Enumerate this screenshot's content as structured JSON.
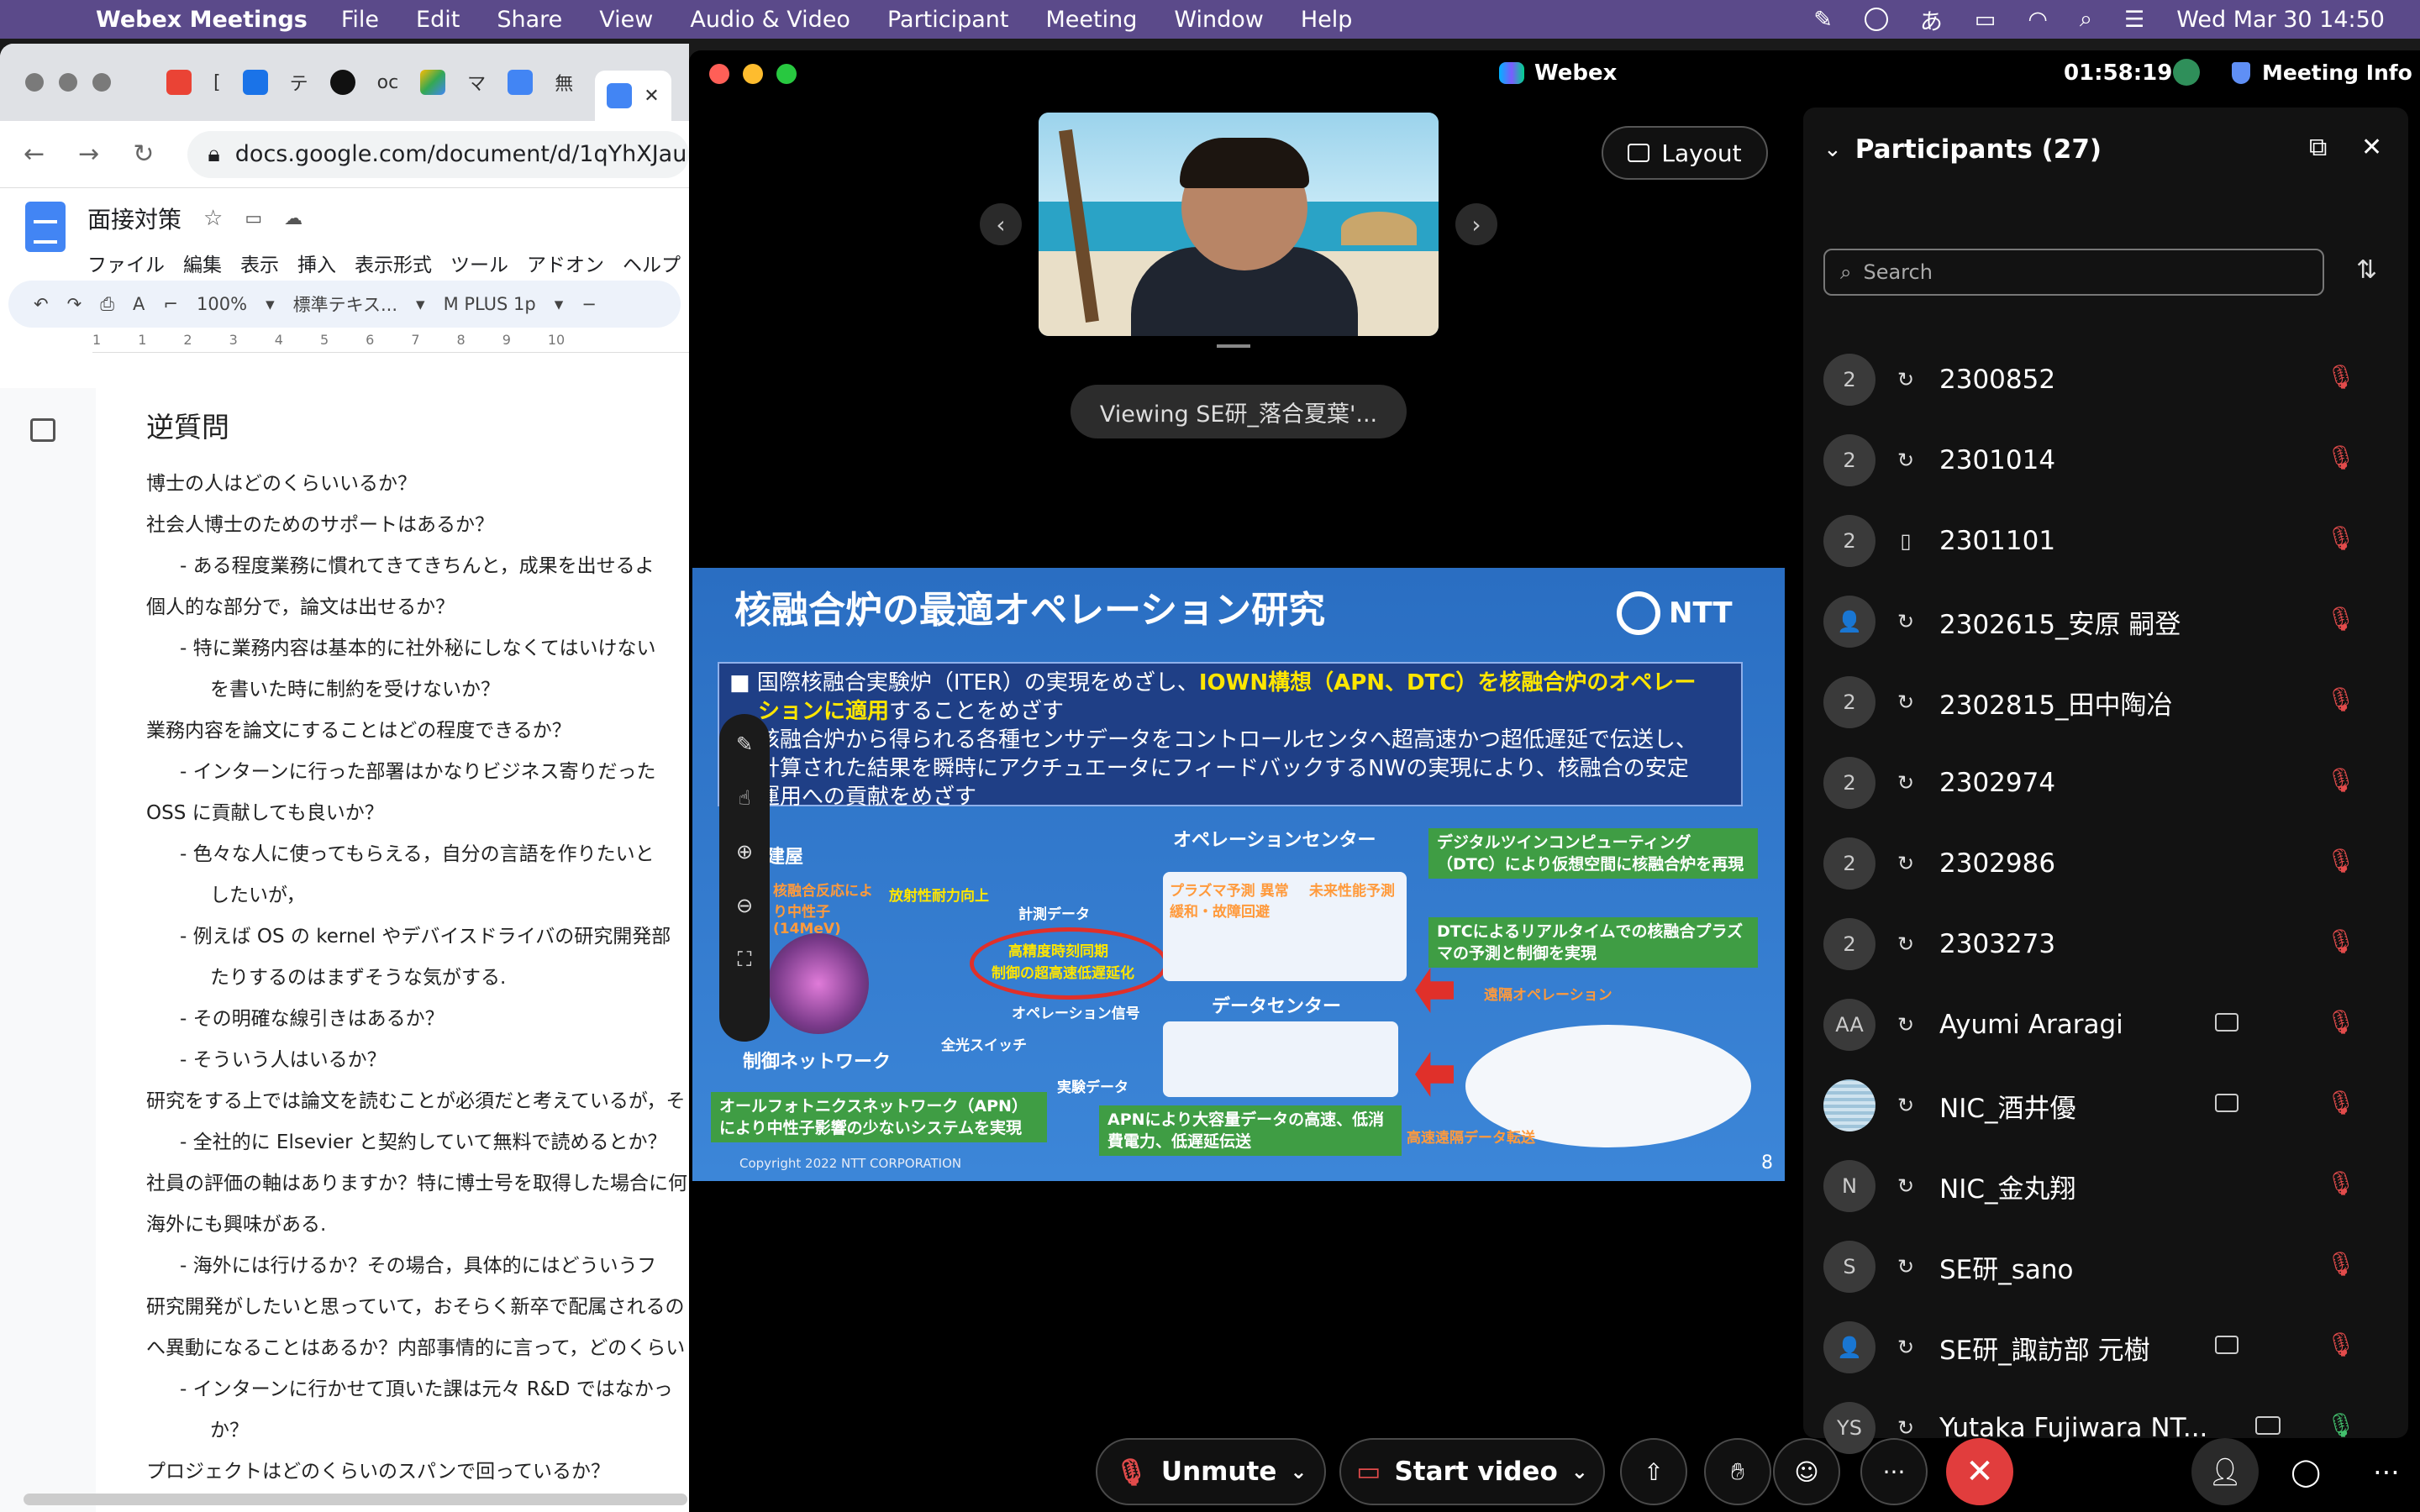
{
  "menubar": {
    "app": "Webex Meetings",
    "items": [
      "File",
      "Edit",
      "Share",
      "View",
      "Audio & Video",
      "Participant",
      "Meeting",
      "Window",
      "Help"
    ],
    "ime": "あ",
    "clock": "Wed Mar 30  14:50"
  },
  "chrome": {
    "tab_letters": [
      "[",
      "テ",
      "oc",
      "マ",
      "無"
    ],
    "url": "docs.google.com/document/d/1qYhXJau",
    "doc_title": "面接対策",
    "doc_menu": [
      "ファイル",
      "編集",
      "表示",
      "挿入",
      "表示形式",
      "ツール",
      "アドオン",
      "ヘルプ"
    ],
    "zoom": "100%",
    "style": "標準テキス...",
    "font": "M PLUS 1p",
    "ruler_marks": [
      "1",
      "1",
      "2",
      "3",
      "4",
      "5",
      "6",
      "7",
      "8",
      "9",
      "10"
    ],
    "heading": "逆質問",
    "lines": [
      {
        "lvl": "a",
        "text": "博士の人はどのくらいいるか？"
      },
      {
        "lvl": "a",
        "text": "社会人博士のためのサポートはあるか？"
      },
      {
        "lvl": "b",
        "text": "-    ある程度業務に慣れてきてきちんと，成果を出せるよ"
      },
      {
        "lvl": "a",
        "text": "個人的な部分で，論文は出せるか？"
      },
      {
        "lvl": "b",
        "text": "-    特に業務内容は基本的に社外秘にしなくてはいけない"
      },
      {
        "lvl": "c",
        "text": "を書いた時に制約を受けないか？"
      },
      {
        "lvl": "a",
        "text": "業務内容を論文にすることはどの程度できるか？"
      },
      {
        "lvl": "b",
        "text": "-    インターンに行った部署はかなりビジネス寄りだった"
      },
      {
        "lvl": "a",
        "text": "OSS に貢献しても良いか？"
      },
      {
        "lvl": "b",
        "text": "-    色々な人に使ってもらえる，自分の言語を作りたいと"
      },
      {
        "lvl": "c",
        "text": "したいが，"
      },
      {
        "lvl": "b",
        "text": "-    例えば OS の kernel やデバイスドライバの研究開発部"
      },
      {
        "lvl": "c",
        "text": "たりするのはまずそうな気がする."
      },
      {
        "lvl": "b",
        "text": "-    その明確な線引きはあるか？"
      },
      {
        "lvl": "b",
        "text": "-    そういう人はいるか？"
      },
      {
        "lvl": "a",
        "text": "研究をする上では論文を読むことが必須だと考えているが，そ"
      },
      {
        "lvl": "b",
        "text": "-    全社的に Elsevier と契約していて無料で読めるとか？"
      },
      {
        "lvl": "a",
        "text": "社員の評価の軸はありますか？特に博士号を取得した場合に何"
      },
      {
        "lvl": "a",
        "text": "海外にも興味がある."
      },
      {
        "lvl": "b",
        "text": "-    海外には行けるか？その場合，具体的にはどういうフ"
      },
      {
        "lvl": "a",
        "text": "研究開発がしたいと思っていて，おそらく新卒で配属されるの"
      },
      {
        "lvl": "a",
        "text": "へ異動になることはあるか？内部事情的に言って，どのくらい"
      },
      {
        "lvl": "b",
        "text": "-    インターンに行かせて頂いた課は元々 R&D ではなかっ"
      },
      {
        "lvl": "c",
        "text": "か？"
      },
      {
        "lvl": "a",
        "text": "プロジェクトはどのくらいのスパンで回っているか？"
      }
    ]
  },
  "webex": {
    "title": "Webex",
    "timer": "01:58:19",
    "meeting_info": "Meeting Info",
    "layout": "Layout",
    "viewing": "Viewing SE研_落合夏葉'...",
    "slide": {
      "title": "核融合炉の最適オペレーション研究",
      "logo": "NTT",
      "box_line1_a": "■ 国際核融合実験炉（ITER）の実現をめざし、",
      "box_line1_b": "IOWN構想（APN、DTC）を核融合炉のオペレー",
      "box_line2_a": "ションに適用",
      "box_line2_b": "することをめざす",
      "box_line3": "核融合炉から得られる各種センサデータをコントロールセンタへ超高速かつ超低遅延で伝送し、",
      "box_line4": "計算された結果を瞬時にアクチュエータにフィードバックするNWの実現により、核融合の安定",
      "box_line5": "運用への貢献をめざす",
      "building": "建屋",
      "op_center": "オペレーションセンター",
      "dtc_box": "デジタルツインコンピューティング（DTC）により仮想空間に核融合炉を再現",
      "dtc_rt": "DTCによるリアルタイムでの核融合プラズマの予測と制御を実現",
      "data_center": "データセンター",
      "control_nw": "制御ネットワーク",
      "apn_box": "オールフォトニクスネットワーク（APN）により中性子影響の少ないシステムを実現",
      "apn_dc": "APNにより大容量データの高速、低消費電力、低遅延伝送",
      "remote_op": "遠隔オペレーション",
      "remote_data": "高速遠隔データ転送",
      "measure": "計測データ",
      "op_signal": "オペレーション信号",
      "exp_data": "実験データ",
      "sync": "高精度時刻同期",
      "low_latency": "制御の超高速低遅延化",
      "radiation": "放射性耐力向上",
      "optical_switch": "全光スイッチ",
      "plasma": "プラズマ予測 異常緩和・故障回避",
      "future": "未来性能予測",
      "neutron": "核融合反応により中性子(14MeV)",
      "copyright": "Copyright 2022 NTT CORPORATION",
      "page": "8"
    },
    "participants": {
      "title": "Participants (27)",
      "search_placeholder": "Search",
      "list": [
        {
          "avatar": "2",
          "name": "2300852",
          "conn": "↻",
          "mic": "off"
        },
        {
          "avatar": "2",
          "name": "2301014",
          "conn": "↻",
          "mic": "off"
        },
        {
          "avatar": "2",
          "name": "2301101",
          "conn": "▯",
          "mic": "off"
        },
        {
          "avatar": "👤",
          "name": "2302615_安原 嗣登",
          "conn": "↻",
          "mic": "off"
        },
        {
          "avatar": "2",
          "name": "2302815_田中陶冶",
          "conn": "↻",
          "mic": "off"
        },
        {
          "avatar": "2",
          "name": "2302974",
          "conn": "↻",
          "mic": "off"
        },
        {
          "avatar": "2",
          "name": "2302986",
          "conn": "↻",
          "mic": "off"
        },
        {
          "avatar": "2",
          "name": "2303273",
          "conn": "↻",
          "mic": "off"
        },
        {
          "avatar": "AA",
          "name": "Ayumi Araragi",
          "conn": "↻",
          "mic": "off",
          "badge": true
        },
        {
          "avatar": "",
          "name": "NIC_酒井優",
          "conn": "↻",
          "mic": "off",
          "badge": true,
          "img": true
        },
        {
          "avatar": "N",
          "name": "NIC_金丸翔",
          "conn": "↻",
          "mic": "off"
        },
        {
          "avatar": "S",
          "name": "SE研_sano",
          "conn": "↻",
          "mic": "off"
        },
        {
          "avatar": "👤",
          "name": "SE研_諏訪部 元樹",
          "conn": "↻",
          "mic": "off",
          "badge": true
        },
        {
          "avatar": "YS",
          "name": "Yutaka Fujiwara NT...",
          "conn": "↻",
          "mic": "on",
          "video": true
        }
      ]
    },
    "controls": {
      "unmute": "Unmute",
      "start_video": "Start video",
      "more": "···"
    }
  }
}
